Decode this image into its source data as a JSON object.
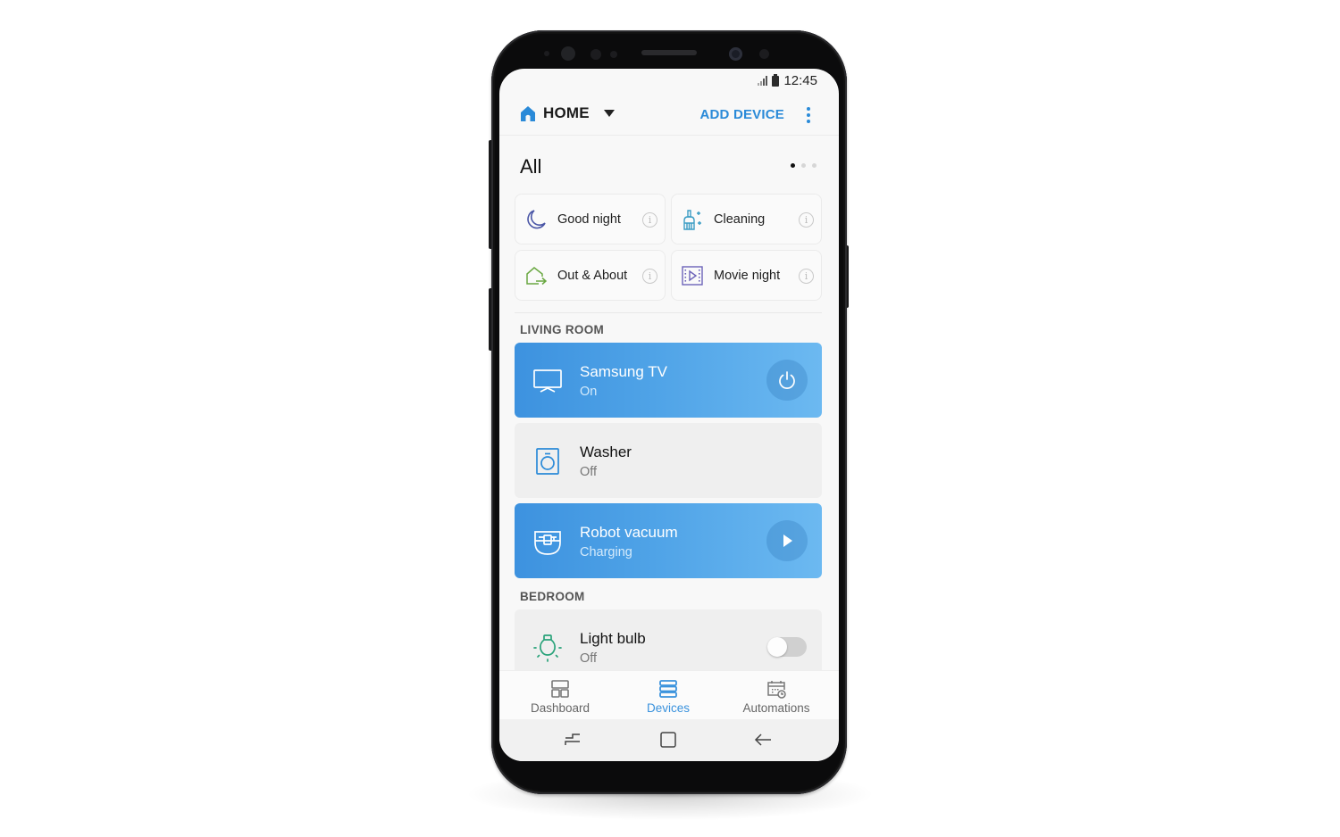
{
  "status_bar": {
    "time": "12:45",
    "signal_icon": "signal-icon",
    "battery_icon": "battery-icon"
  },
  "header": {
    "home_icon": "home-icon",
    "location_label": "HOME",
    "dropdown_icon": "caret-down-icon",
    "add_device_label": "ADD DEVICE",
    "more_icon": "more-vertical-icon"
  },
  "scenes_section": {
    "title": "All",
    "pager": {
      "pages": 3,
      "current": 1
    },
    "scenes": [
      {
        "label": "Good night",
        "icon": "moon-icon",
        "color": "#4a56a6"
      },
      {
        "label": "Cleaning",
        "icon": "cleaning-brush-icon",
        "color": "#3a9cc4"
      },
      {
        "label": "Out & About",
        "icon": "house-exit-icon",
        "color": "#6aa842"
      },
      {
        "label": "Movie night",
        "icon": "movie-icon",
        "color": "#6b62b8"
      }
    ],
    "info_glyph": "i"
  },
  "rooms": [
    {
      "name": "LIVING ROOM",
      "devices": [
        {
          "name": "Samsung TV",
          "status": "On",
          "icon": "tv-icon",
          "active": true,
          "action": "power-icon"
        },
        {
          "name": "Washer",
          "status": "Off",
          "icon": "washer-icon",
          "active": false,
          "action": null
        },
        {
          "name": "Robot vacuum",
          "status": "Charging",
          "icon": "robot-vacuum-icon",
          "active": true,
          "action": "play-icon"
        }
      ]
    },
    {
      "name": "BEDROOM",
      "devices": [
        {
          "name": "Light bulb",
          "status": "Off",
          "icon": "light-bulb-icon",
          "active": false,
          "action": "toggle",
          "toggle_on": false
        }
      ]
    }
  ],
  "bottom_nav": {
    "items": [
      {
        "label": "Dashboard",
        "icon": "dashboard-icon",
        "active": false
      },
      {
        "label": "Devices",
        "icon": "devices-icon",
        "active": true
      },
      {
        "label": "Automations",
        "icon": "automations-icon",
        "active": false
      }
    ]
  },
  "system_nav": {
    "items": [
      "recent-apps-icon",
      "home-square-icon",
      "back-arrow-icon"
    ]
  },
  "colors": {
    "accent": "#2a8ad8",
    "active_card_start": "#3d92df",
    "active_card_end": "#6cb9f1",
    "inactive_card": "#efefef",
    "light_bulb_icon": "#2aa37a"
  }
}
